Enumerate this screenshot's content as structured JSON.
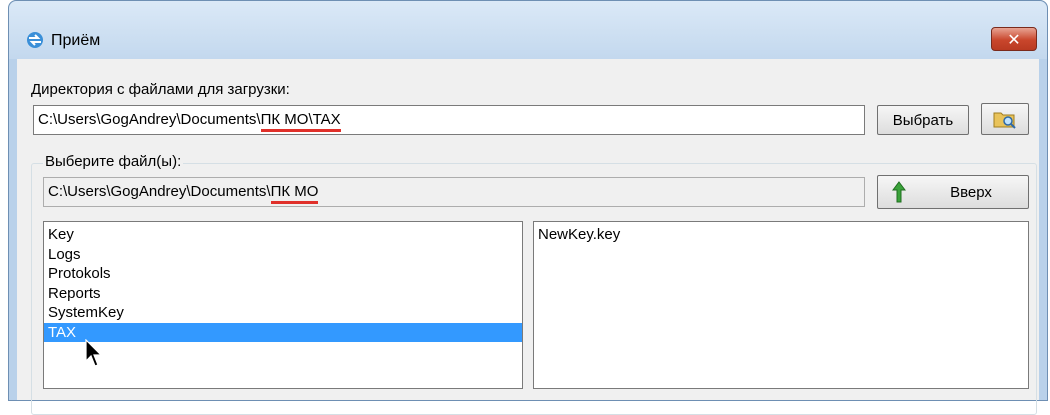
{
  "window": {
    "title": "Приём",
    "close_icon": "close-icon",
    "app_icon": "exchange-icon"
  },
  "source": {
    "label": "Директория с файлами для загрузки:",
    "path_prefix": "C:\\Users\\GogAndrey\\Documents\\",
    "path_highlight": "ПК МО\\TAX",
    "choose_label": "Выбрать",
    "browse_icon": "folder-search-icon"
  },
  "picker": {
    "label": "Выберите файл(ы):",
    "path_prefix": "C:\\Users\\GogAndrey\\Documents\\",
    "path_highlight": "ПК МО",
    "up_label": "Вверх",
    "up_icon": "arrow-up-icon"
  },
  "folders": [
    "Key",
    "Logs",
    "Protokols",
    "Reports",
    "SystemKey",
    "TAX"
  ],
  "selected_folder": "TAX",
  "files": [
    "NewKey.key"
  ],
  "colors": {
    "selection": "#3399ff",
    "underline": "#e0302a",
    "up_arrow": "#3aa23a"
  }
}
